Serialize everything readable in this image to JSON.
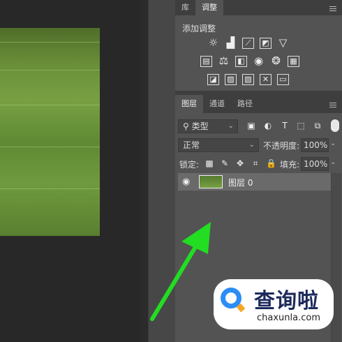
{
  "top_tabs": {
    "library": "库",
    "adjustments": "调整"
  },
  "adjustments": {
    "title": "添加调整"
  },
  "layer_tabs": {
    "layers": "图层",
    "channels": "通道",
    "paths": "路径"
  },
  "filter": {
    "value": "类型"
  },
  "blend": {
    "mode": "正常",
    "opacity_label": "不透明度:",
    "opacity_value": "100%"
  },
  "lock": {
    "label": "锁定:",
    "fill_label": "填充:",
    "fill_value": "100%"
  },
  "layer": {
    "name": "图层 0"
  },
  "watermark": {
    "brand": "查询啦",
    "url": "chaxunla.com"
  },
  "colors": {
    "arrow": "#22dd22",
    "panel": "#535353",
    "accent": "#2c8ef5"
  }
}
